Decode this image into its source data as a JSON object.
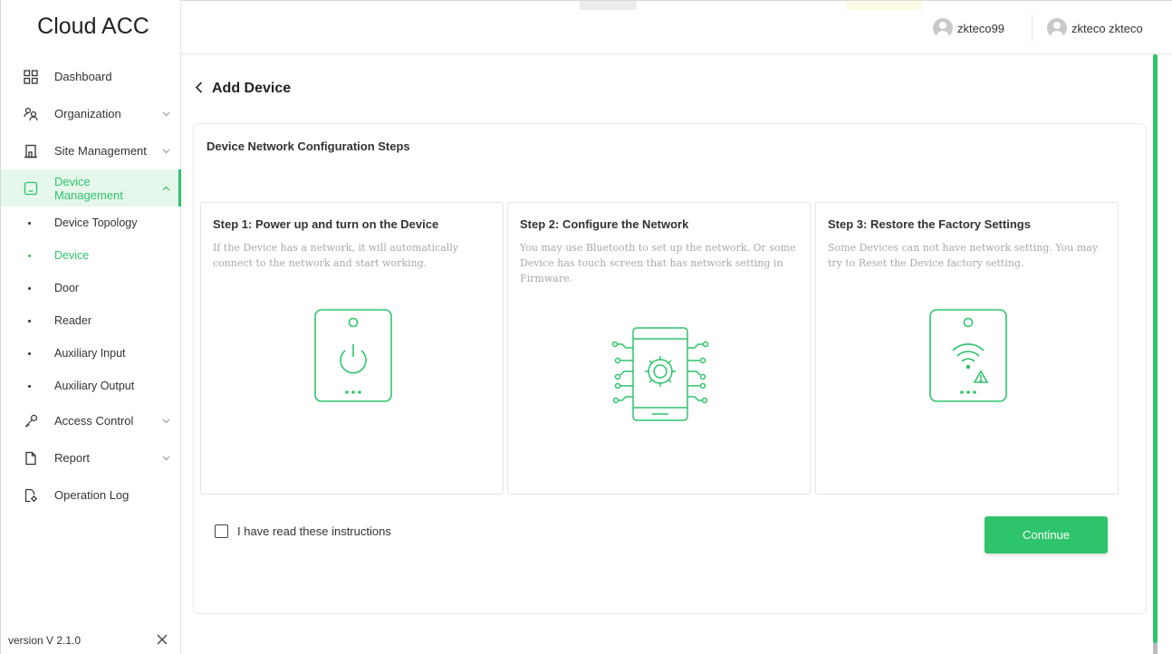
{
  "app": {
    "brand": "Cloud ACC",
    "version": "version V 2.1.0"
  },
  "colors": {
    "accent": "#2ec46b",
    "muted_text": "#a9a9a9"
  },
  "sidebar": {
    "items": [
      {
        "label": "Dashboard",
        "icon": "dashboard-icon"
      },
      {
        "label": "Organization",
        "icon": "organization-icon"
      },
      {
        "label": "Site Management",
        "icon": "building-icon"
      },
      {
        "label": "Device Management",
        "icon": "device-icon"
      },
      {
        "label": "Access Control",
        "icon": "key-icon"
      },
      {
        "label": "Report",
        "icon": "document-icon"
      },
      {
        "label": "Operation Log",
        "icon": "file-gear-icon"
      }
    ],
    "sub_items": [
      {
        "label": "Device Topology"
      },
      {
        "label": "Device"
      },
      {
        "label": "Door"
      },
      {
        "label": "Reader"
      },
      {
        "label": "Auxiliary Input"
      },
      {
        "label": "Auxiliary Output"
      }
    ]
  },
  "header": {
    "user1": "zkteco99",
    "user2": "zkteco zkteco"
  },
  "page": {
    "title": "Add Device",
    "panel_title": "Device Network Configuration Steps",
    "steps": [
      {
        "title": "Step 1: Power up and turn on the Device",
        "desc": "If the Device has a network, it will automatically connect to the network and start working.",
        "icon": "device-power-icon"
      },
      {
        "title": "Step 2: Configure the Network",
        "desc": "You may use Bluetooth to set up the network. Or some Device has touch screen that has network setting in Firmware.",
        "icon": "phone-network-gear-icon"
      },
      {
        "title": "Step 3: Restore the Factory Settings",
        "desc": "Some Devices can not have network setting. You may try to Reset the Device factory setting.",
        "icon": "device-wifi-warning-icon"
      }
    ],
    "checkbox_label": "I have read these instructions",
    "checkbox_checked": false,
    "continue_label": "Continue"
  }
}
